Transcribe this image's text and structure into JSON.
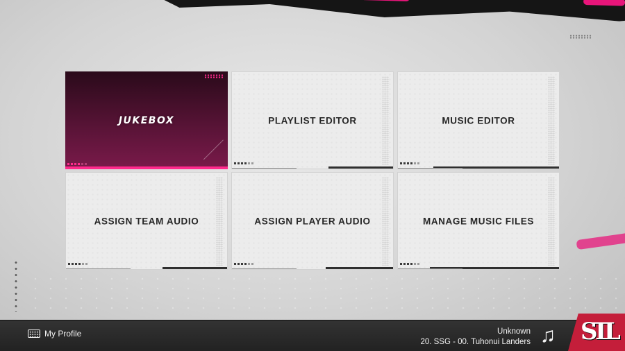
{
  "menu": {
    "tiles": [
      {
        "label": "JUKEBOX",
        "selected": true
      },
      {
        "label": "PLAYLIST EDITOR",
        "selected": false
      },
      {
        "label": "MUSIC EDITOR",
        "selected": false
      },
      {
        "label": "ASSIGN TEAM AUDIO",
        "selected": false
      },
      {
        "label": "ASSIGN PLAYER AUDIO",
        "selected": false
      },
      {
        "label": "MANAGE MUSIC FILES",
        "selected": false
      }
    ]
  },
  "footer": {
    "profile_label": "My Profile",
    "profile_icon": "keyboard-icon",
    "now_playing_artist": "Unknown",
    "now_playing_track": "20. SSG - 00. Tuhonui Landers",
    "music_icon": "music-note-icon",
    "team_logo_icon": "team-logo-icon"
  },
  "colors": {
    "accent": "#ff2a8c",
    "selected_tile": "#4a0e2a",
    "team_red": "#c41e3a"
  }
}
